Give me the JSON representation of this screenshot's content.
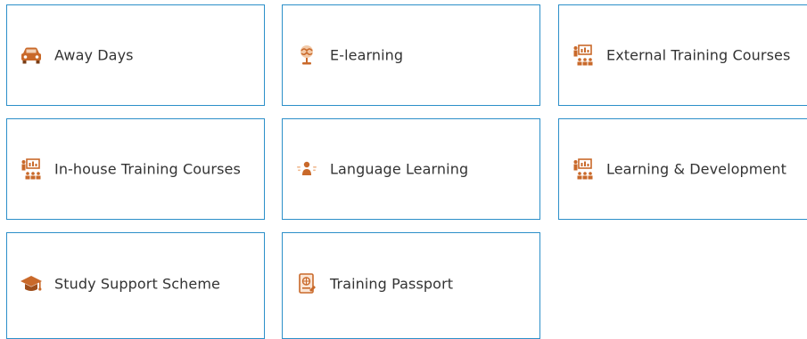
{
  "colors": {
    "tile_border": "#2c8fc9",
    "icon_accent": "#c9692a",
    "text": "#333333"
  },
  "tiles": [
    {
      "label": "Away Days",
      "icon": "car-icon"
    },
    {
      "label": "E-learning",
      "icon": "brain-globe-icon"
    },
    {
      "label": "External Training Courses",
      "icon": "classroom-presentation-icon"
    },
    {
      "label": "In-house Training Courses",
      "icon": "classroom-presentation-icon"
    },
    {
      "label": "Language Learning",
      "icon": "speaking-person-icon"
    },
    {
      "label": "Learning & Development",
      "icon": "classroom-presentation-icon"
    },
    {
      "label": "Study Support Scheme",
      "icon": "graduation-cap-icon"
    },
    {
      "label": "Training Passport",
      "icon": "passport-icon"
    }
  ]
}
